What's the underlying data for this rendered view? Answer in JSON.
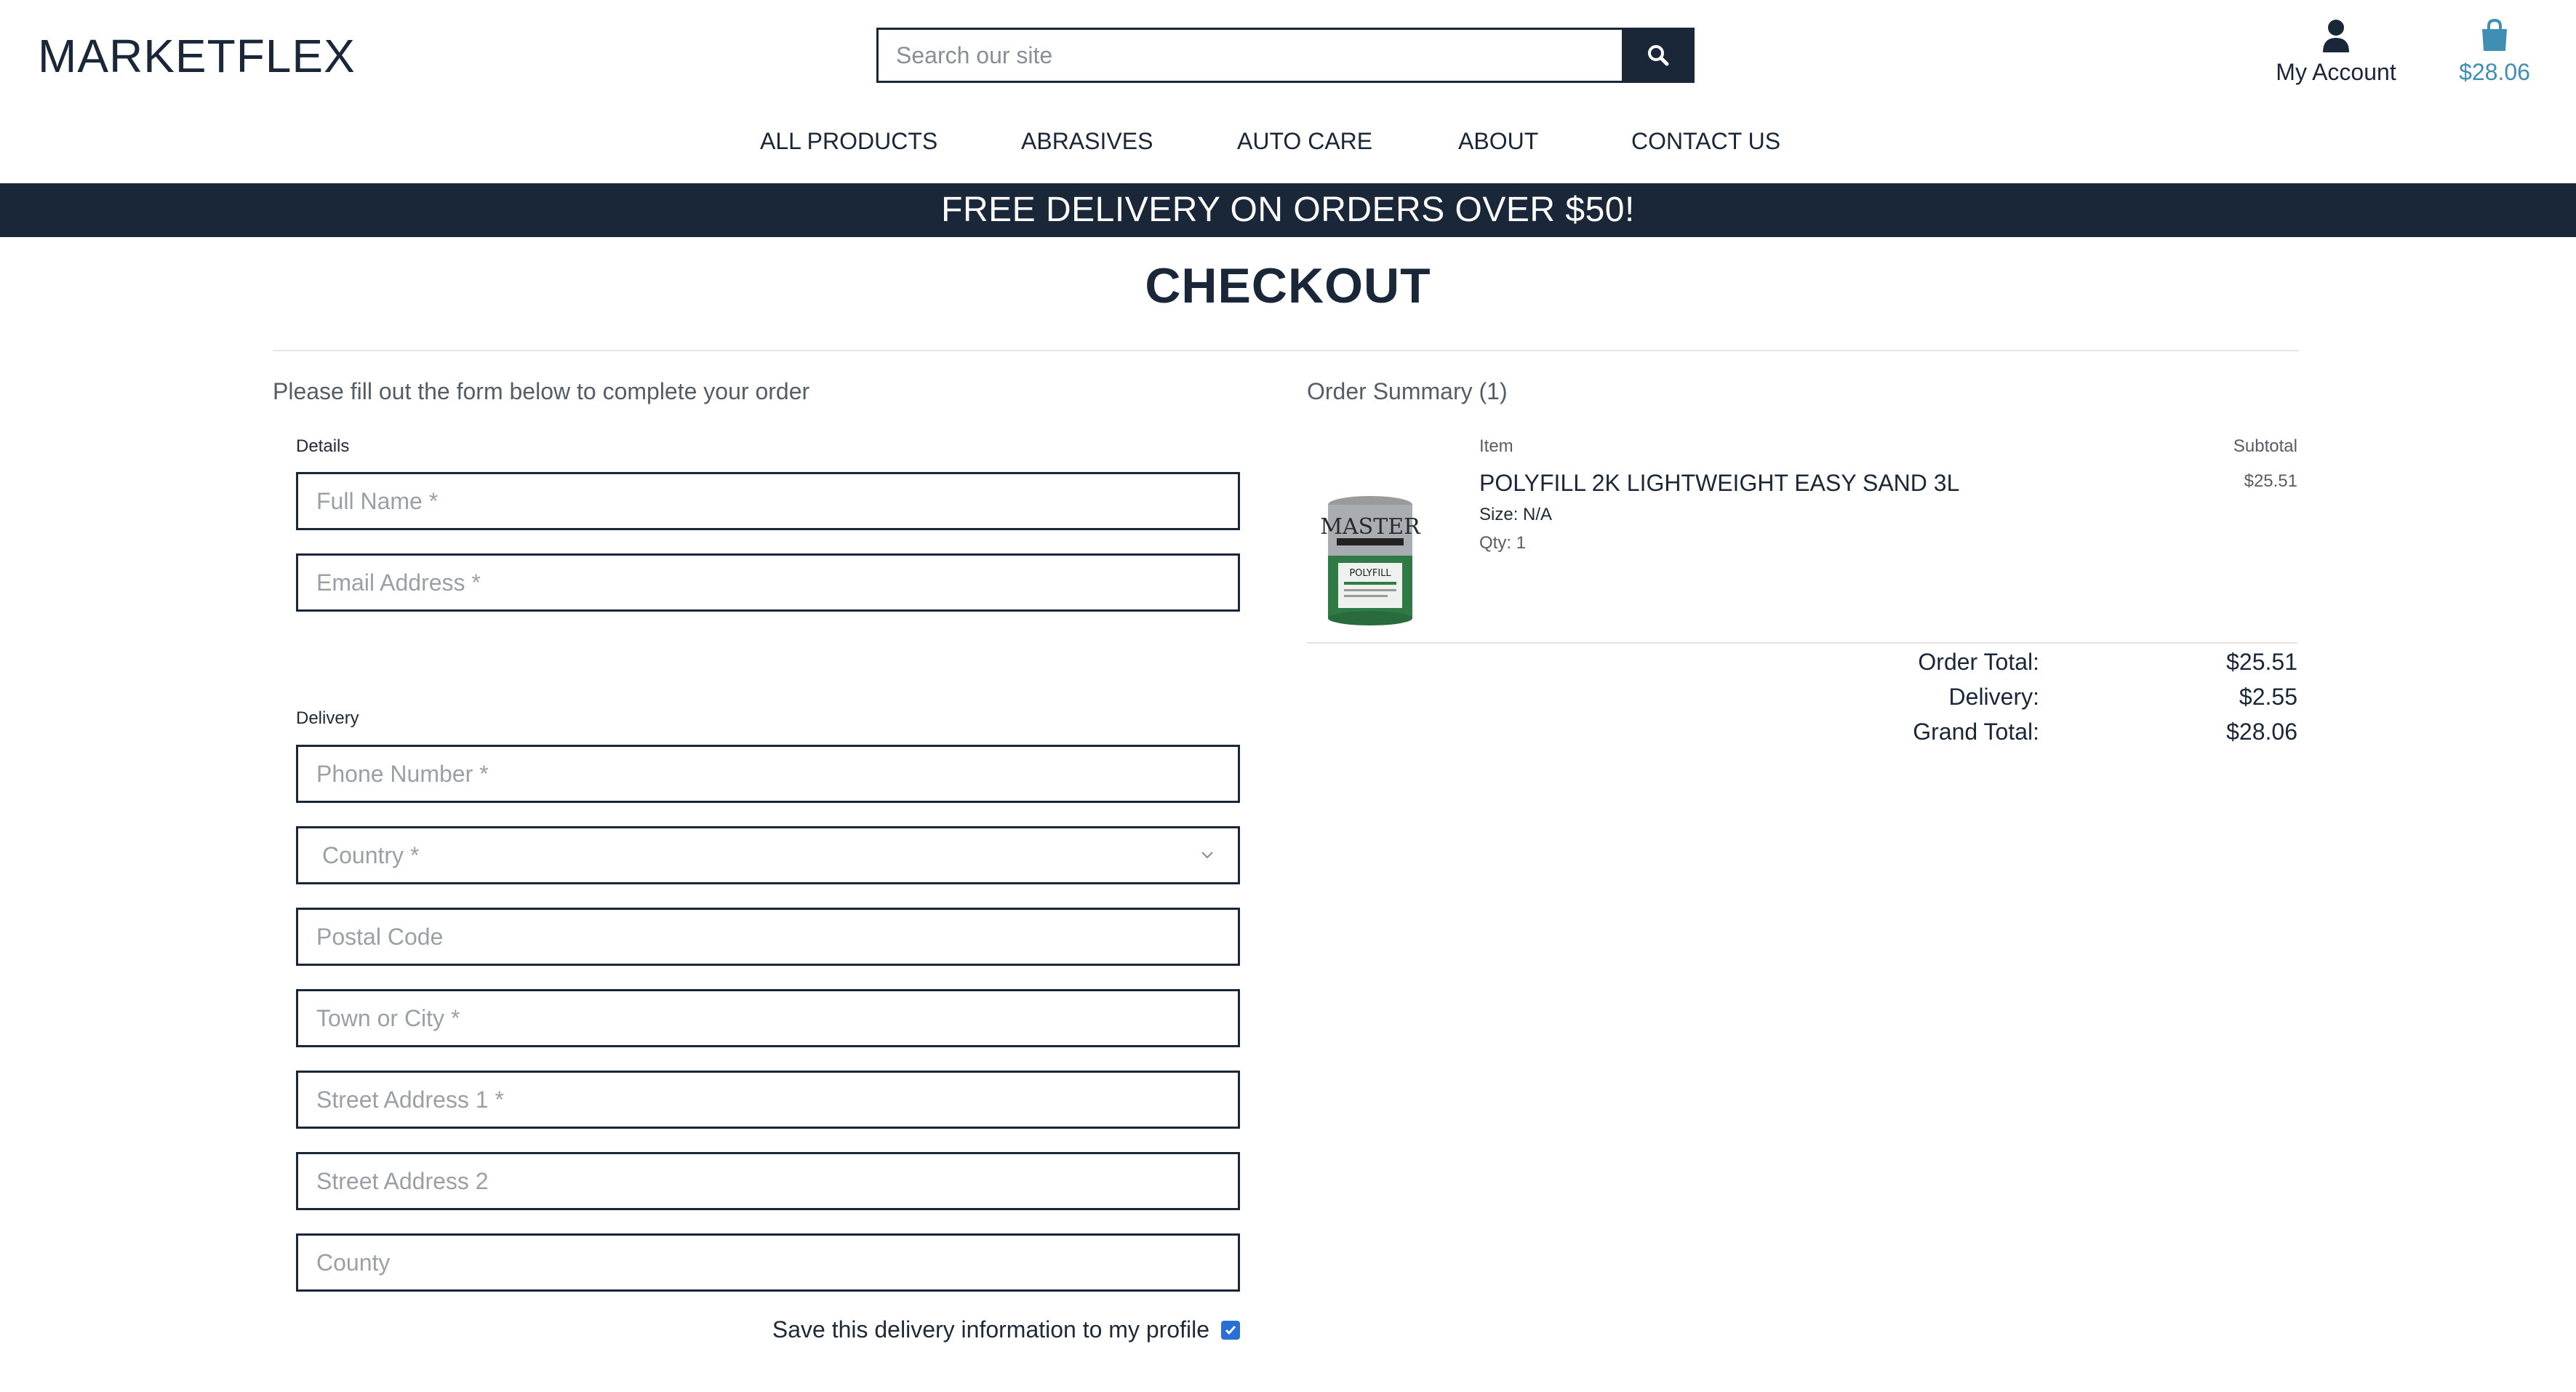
{
  "header": {
    "logo": "MARKETFLEX",
    "search_placeholder": "Search our site",
    "account_label": "My Account",
    "bag_total": "$28.06"
  },
  "nav": {
    "items": [
      "ALL PRODUCTS",
      "ABRASIVES",
      "AUTO CARE",
      "ABOUT",
      "CONTACT US"
    ]
  },
  "banner": "FREE DELIVERY ON ORDERS OVER $50!",
  "page_title": "CHECKOUT",
  "form": {
    "intro": "Please fill out the form below to complete your order",
    "details_label": "Details",
    "full_name_placeholder": "Full Name *",
    "email_placeholder": "Email Address *",
    "delivery_label": "Delivery",
    "phone_placeholder": "Phone Number *",
    "country_placeholder": "Country *",
    "postal_placeholder": "Postal Code",
    "town_placeholder": "Town or City *",
    "street1_placeholder": "Street Address 1 *",
    "street2_placeholder": "Street Address 2",
    "county_placeholder": "County",
    "save_label": "Save this delivery information to my profile",
    "save_checked": true
  },
  "summary": {
    "title": "Order Summary (1)",
    "item_header": "Item",
    "subtotal_header": "Subtotal",
    "product": {
      "name": "POLYFILL 2K LIGHTWEIGHT EASY SAND 3L",
      "size": "Size: N/A",
      "qty": "Qty: 1",
      "subtotal": "$25.51",
      "can_brand": "MASTER",
      "can_label": "POLYFILL"
    },
    "order_total_label": "Order Total:",
    "order_total": "$25.51",
    "delivery_label": "Delivery:",
    "delivery": "$2.55",
    "grand_total_label": "Grand Total:",
    "grand_total": "$28.06"
  },
  "colors": {
    "navy": "#1a2738",
    "accent_blue": "#3e8fb3",
    "checkbox_blue": "#2a6fd6"
  }
}
